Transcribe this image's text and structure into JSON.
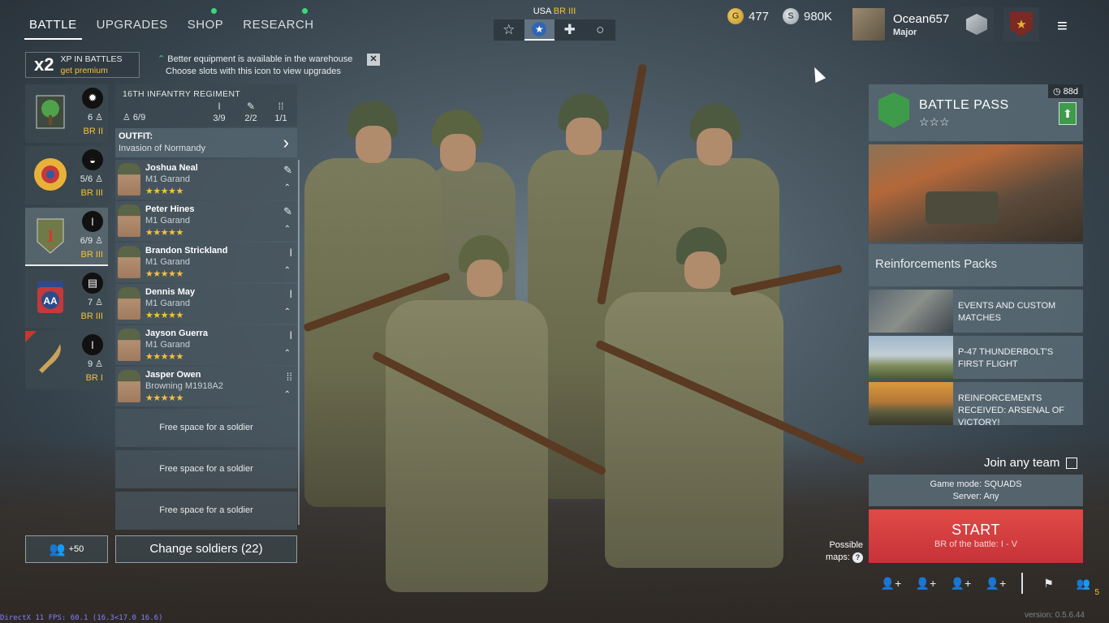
{
  "nav": {
    "tabs": [
      {
        "label": "BATTLE",
        "active": true,
        "dot": false
      },
      {
        "label": "UPGRADES",
        "active": false,
        "dot": false
      },
      {
        "label": "SHOP",
        "active": false,
        "dot": true
      },
      {
        "label": "RESEARCH",
        "active": false,
        "dot": true
      }
    ]
  },
  "nation": {
    "name": "USA",
    "br": "BR III"
  },
  "currency": {
    "gold": "477",
    "silver": "980K"
  },
  "profile": {
    "name": "Ocean657",
    "rank": "Major"
  },
  "xp": {
    "mult": "x2",
    "line1": "XP IN BATTLES",
    "line2": "get premium"
  },
  "notice": {
    "line1": "Better equipment is available in the warehouse",
    "line2": "Choose slots with this icon to view upgrades"
  },
  "squads": [
    {
      "count": "6",
      "br": "BR II"
    },
    {
      "count": "5/6",
      "br": "BR III"
    },
    {
      "count": "6/9",
      "br": "BR III"
    },
    {
      "count": "7",
      "br": "BR III"
    },
    {
      "count": "9",
      "br": "BR I"
    }
  ],
  "regiment": {
    "name": "16TH INFANTRY REGIMENT",
    "count": "6/9",
    "slot1": "3/9",
    "slot2": "2/2",
    "slot3": "1/1"
  },
  "outfit": {
    "label": "OUTFIT:",
    "value": "Invasion of Normandy"
  },
  "soldiers": [
    {
      "name": "Joshua Neal",
      "weapon": "M1 Garand",
      "stars": "★★★★★"
    },
    {
      "name": "Peter Hines",
      "weapon": "M1 Garand",
      "stars": "★★★★★"
    },
    {
      "name": "Brandon Strickland",
      "weapon": "M1 Garand",
      "stars": "★★★★★"
    },
    {
      "name": "Dennis May",
      "weapon": "M1 Garand",
      "stars": "★★★★★"
    },
    {
      "name": "Jayson Guerra",
      "weapon": "M1 Garand",
      "stars": "★★★★★"
    },
    {
      "name": "Jasper Owen",
      "weapon": "Browning M1918A2",
      "stars": "★★★★★"
    }
  ],
  "free_slot": "Free space for a soldier",
  "buttons": {
    "recruit": "+50",
    "change": "Change soldiers (22)"
  },
  "battle_pass": {
    "title": "BATTLE PASS",
    "days": "88d",
    "stars": "☆☆☆"
  },
  "reinforcements": "Reinforcements Packs",
  "events": [
    {
      "title": "EVENTS AND CUSTOM MATCHES"
    },
    {
      "title": "P-47 THUNDERBOLT'S FIRST FLIGHT"
    },
    {
      "title": "REINFORCEMENTS RECEIVED: ARSENAL OF VICTORY!"
    }
  ],
  "join": "Join any team",
  "mode": {
    "line1": "Game mode: SQUADS",
    "line2": "Server: Any"
  },
  "start": {
    "title": "START",
    "sub": "BR of the battle: I - V"
  },
  "maps": {
    "line1": "Possible",
    "line2": "maps:"
  },
  "bottom": {
    "badge": "5"
  },
  "fps": "DirectX 11 FPS: 60.1 (16.3<17.0 16.6)",
  "version": "version: 0.5.6.44"
}
